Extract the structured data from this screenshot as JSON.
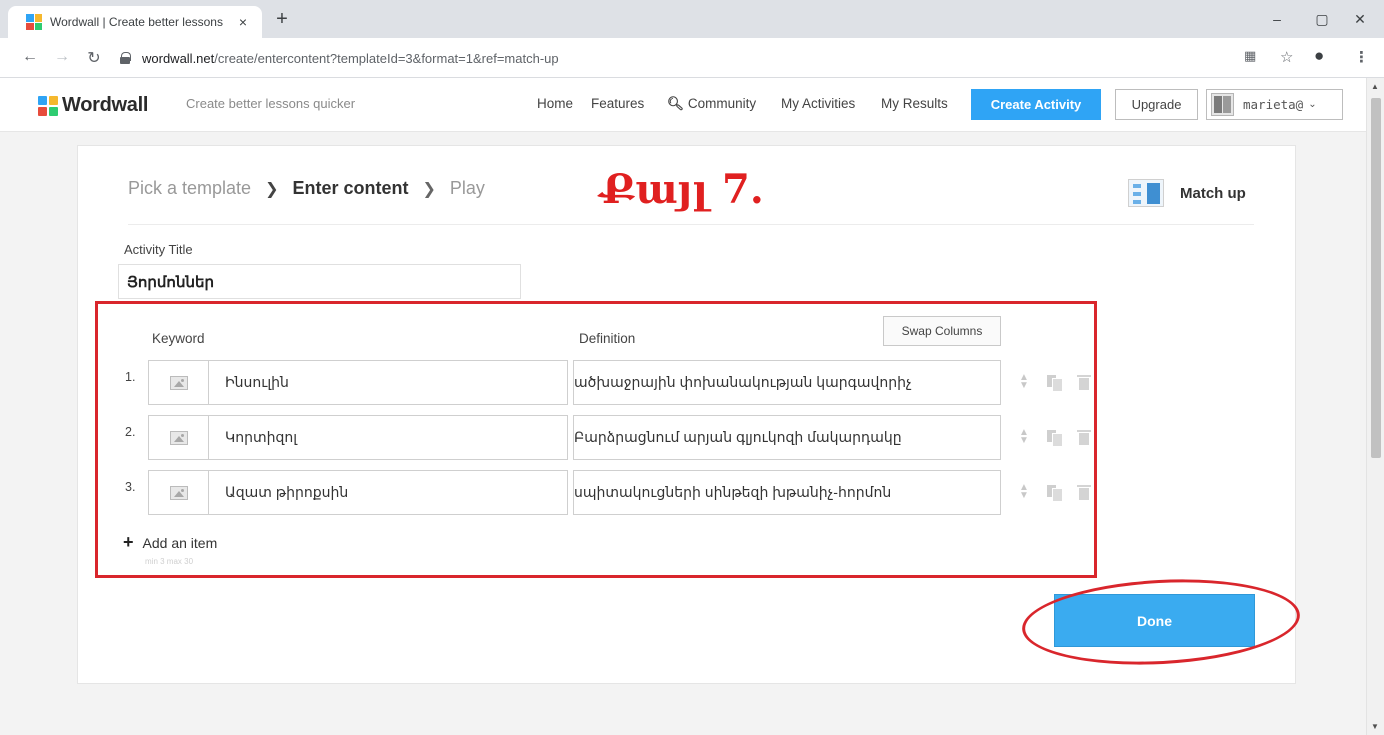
{
  "browser": {
    "tab_title": "Wordwall | Create better lessons",
    "tab_close": "×",
    "new_tab": "+",
    "url_host": "wordwall.net",
    "url_path": "/create/entercontent?templateId=3&format=1&ref=match-up",
    "minimize": "–",
    "restore": "▢",
    "close": "✕"
  },
  "header": {
    "logo": "Wordwall",
    "tagline": "Create better lessons quicker",
    "nav": [
      "Home",
      "Features",
      "Community",
      "My Activities",
      "My Results"
    ],
    "create_label": "Create Activity",
    "upgrade_label": "Upgrade",
    "user_name": "marieta@"
  },
  "steps": {
    "pick": "Pick a template",
    "enter": "Enter content",
    "play": "Play",
    "separator": "›"
  },
  "step_note": "Քայլ 7.",
  "template_name": "Match up",
  "activity_title_label": "Activity Title",
  "activity_title_value": "Յորմոններ",
  "columns": {
    "keyword": "Keyword",
    "definition": "Definition",
    "swap": "Swap Columns"
  },
  "items": [
    {
      "num": "1.",
      "keyword": "Ինսուլին",
      "definition": "ածխաջրային փոխանակության կարգավորիչ"
    },
    {
      "num": "2.",
      "keyword": "Կորտիզոլ",
      "definition": "Բարձրացնում արյան գլյուկոզի մակարդակը"
    },
    {
      "num": "3.",
      "keyword": "Ազատ թիրոքսին",
      "definition": "սպիտակուցների սինթեզի խթանիչ-հորմոն"
    }
  ],
  "add_item_label": "Add an item",
  "limits": "min 3   max 30",
  "done_label": "Done",
  "colors": {
    "accent": "#2fa4f5",
    "annotation_red": "#d9262c"
  }
}
